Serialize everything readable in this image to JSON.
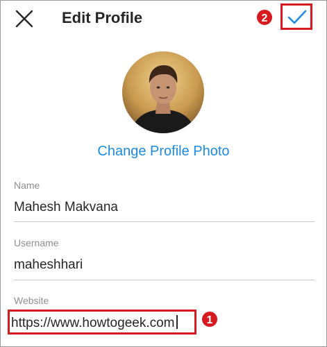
{
  "header": {
    "title": "Edit Profile",
    "step_done": "2"
  },
  "profile": {
    "change_photo_label": "Change Profile Photo"
  },
  "fields": {
    "name": {
      "label": "Name",
      "value": "Mahesh Makvana"
    },
    "username": {
      "label": "Username",
      "value": "maheshhari"
    },
    "website": {
      "label": "Website",
      "value": "https://www.howtogeek.com",
      "step": "1"
    }
  },
  "colors": {
    "accent": "#1c8be0",
    "annotation": "#d71920",
    "text": "#262626",
    "label": "#8e8e8e"
  },
  "icons": {
    "close": "close-icon",
    "done": "checkmark-icon"
  }
}
